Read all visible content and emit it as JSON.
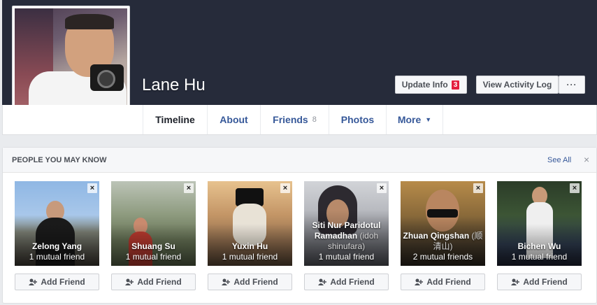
{
  "profile": {
    "name": "Lane Hu",
    "update_info_label": "Update Info",
    "update_info_badge": "3",
    "activity_log_label": "View Activity Log",
    "more_label": "···"
  },
  "tabs": [
    {
      "label": "Timeline",
      "count": ""
    },
    {
      "label": "About",
      "count": ""
    },
    {
      "label": "Friends",
      "count": "8"
    },
    {
      "label": "Photos",
      "count": ""
    },
    {
      "label": "More",
      "count": ""
    }
  ],
  "pymk": {
    "title": "PEOPLE YOU MAY KNOW",
    "see_all": "See All",
    "close": "×",
    "add_label": "Add Friend",
    "dismiss": "×",
    "people": [
      {
        "name": "Zelong Yang",
        "alt": "",
        "mutual": "1 mutual friend"
      },
      {
        "name": "Shuang Su",
        "alt": "",
        "mutual": "1 mutual friend"
      },
      {
        "name": "Yuxin Hu",
        "alt": "",
        "mutual": "1 mutual friend"
      },
      {
        "name": "Siti Nur Paridotul Ramadhan",
        "alt": "(idoh shinufara)",
        "mutual": "1 mutual friend"
      },
      {
        "name": "Zhuan Qingshan",
        "alt": "(顺清山)",
        "mutual": "2 mutual friends"
      },
      {
        "name": "Bichen Wu",
        "alt": "",
        "mutual": "1 mutual friend"
      }
    ]
  }
}
